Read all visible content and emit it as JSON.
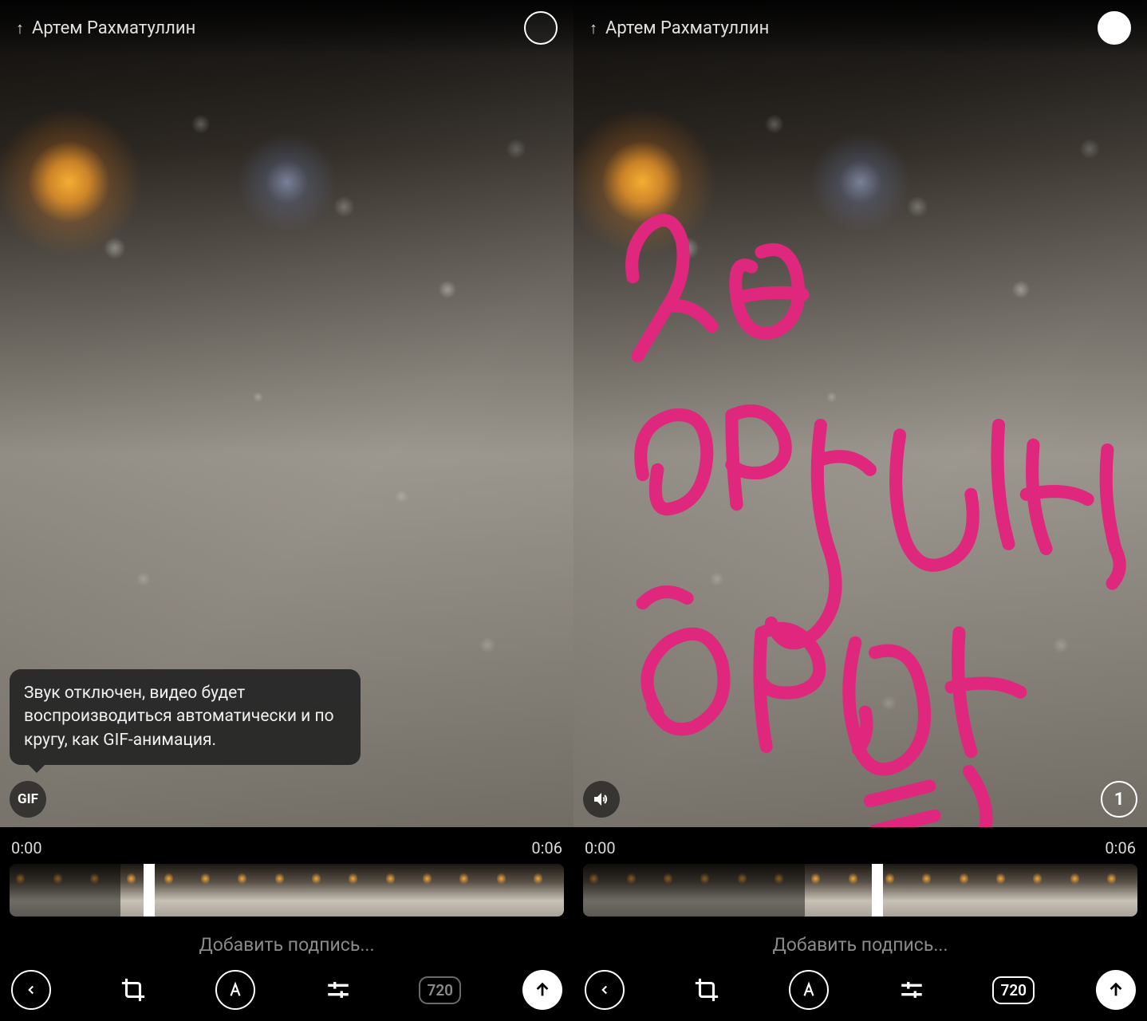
{
  "left": {
    "recipient": "Артем Рахматуллин",
    "tooltip": "Звук отключен, видео будет воспроизводиться автоматически и по кругу, как GIF-анимация.",
    "gif_badge": "GIF",
    "time_start": "0:00",
    "time_end": "0:06",
    "caption_placeholder": "Добавить подпись...",
    "quality": "720"
  },
  "right": {
    "recipient": "Артем Рахматуллин",
    "handwritten_text": "Не грусти, брат =)",
    "count_badge": "1",
    "time_start": "0:00",
    "time_end": "0:06",
    "caption_placeholder": "Добавить подпись...",
    "quality": "720"
  }
}
